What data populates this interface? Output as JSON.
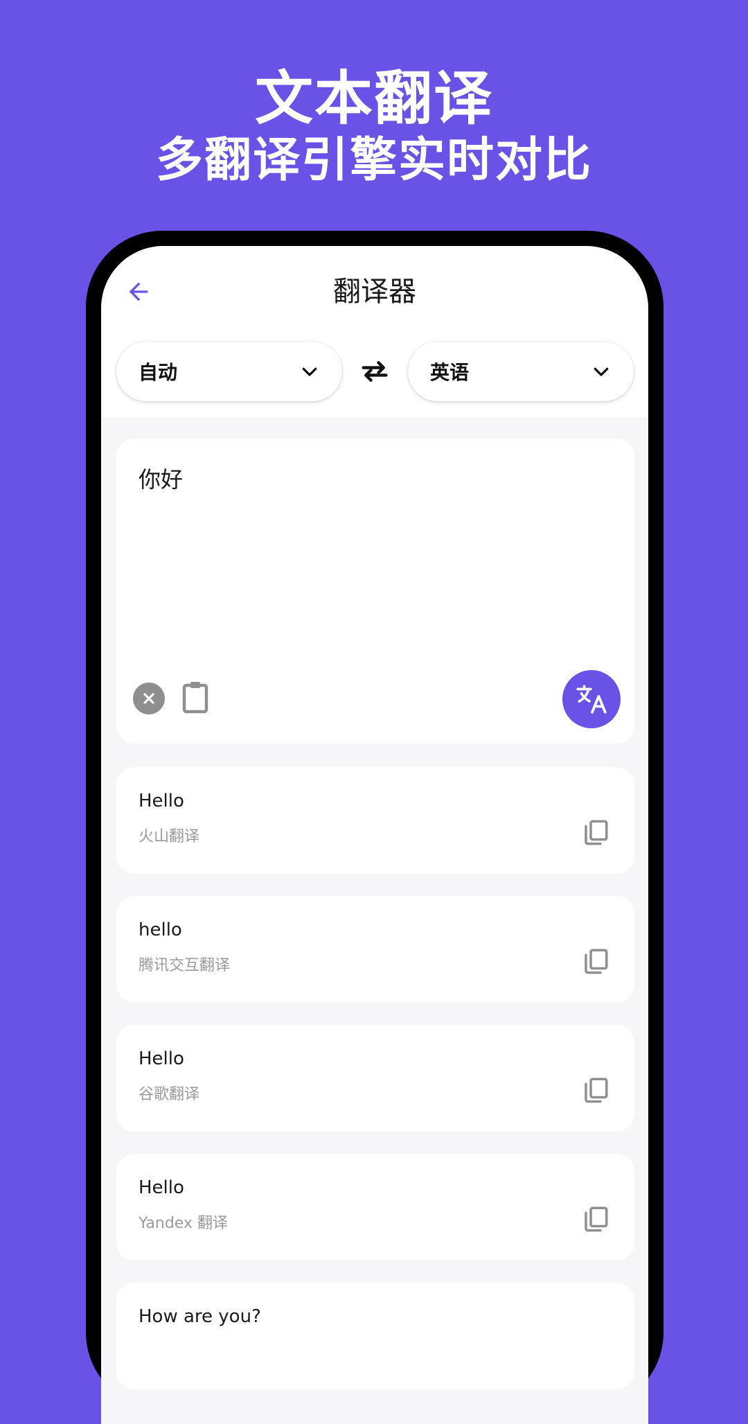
{
  "promo": {
    "title": "文本翻译",
    "subtitle": "多翻译引擎实时对比"
  },
  "header": {
    "back_icon": "arrow-left-icon",
    "title": "翻译器"
  },
  "languages": {
    "source": "自动",
    "target": "英语",
    "swap_icon": "swap-arrows-icon"
  },
  "input": {
    "value": "你好",
    "clear_icon": "clear-circle-icon",
    "paste_icon": "clipboard-icon",
    "translate_icon": "translate-icon"
  },
  "results": [
    {
      "text": "Hello",
      "engine": "火山翻译"
    },
    {
      "text": "hello",
      "engine": "腾讯交互翻译"
    },
    {
      "text": "Hello",
      "engine": "谷歌翻译"
    },
    {
      "text": "Hello",
      "engine": "Yandex 翻译"
    },
    {
      "text": "How are you?",
      "engine": ""
    }
  ],
  "colors": {
    "accent": "#6953e6",
    "background": "#f6f6f8",
    "card": "#ffffff",
    "secondary_text": "#9a9a9a"
  }
}
